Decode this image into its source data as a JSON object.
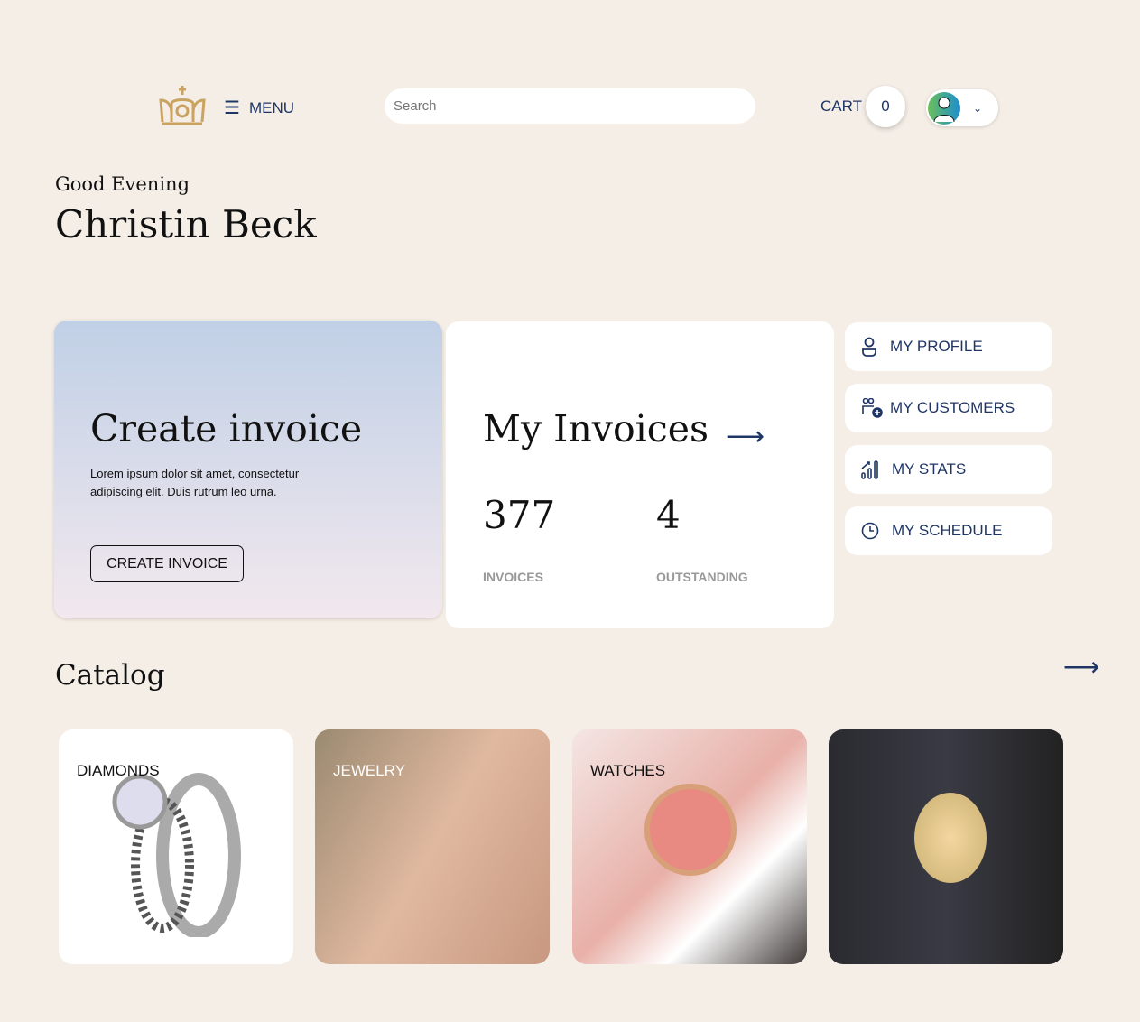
{
  "header": {
    "menu_label": "MENU",
    "search_placeholder": "Search",
    "cart_label": "CART",
    "cart_count": "0"
  },
  "greeting": {
    "salutation": "Good Evening",
    "name": "Christin Beck"
  },
  "create_invoice": {
    "title": "Create invoice",
    "description": "Lorem ipsum dolor sit amet, consectetur adipiscing elit. Duis rutrum leo urna.",
    "button": "CREATE INVOICE"
  },
  "invoices": {
    "title": "My Invoices",
    "invoices_count": "377",
    "invoices_label": "INVOICES",
    "outstanding_count": "4",
    "outstanding_label": "OUTSTANDING"
  },
  "sidebar": {
    "items": [
      {
        "label": "MY PROFILE",
        "icon": "user-icon"
      },
      {
        "label": "MY CUSTOMERS",
        "icon": "customers-add-icon"
      },
      {
        "label": "MY STATS",
        "icon": "stats-icon"
      },
      {
        "label": "MY SCHEDULE",
        "icon": "clock-icon"
      }
    ]
  },
  "catalog": {
    "title": "Catalog",
    "items": [
      {
        "label": "DIAMONDS"
      },
      {
        "label": "JEWELRY"
      },
      {
        "label": "WATCHES"
      },
      {
        "label": ""
      }
    ]
  }
}
